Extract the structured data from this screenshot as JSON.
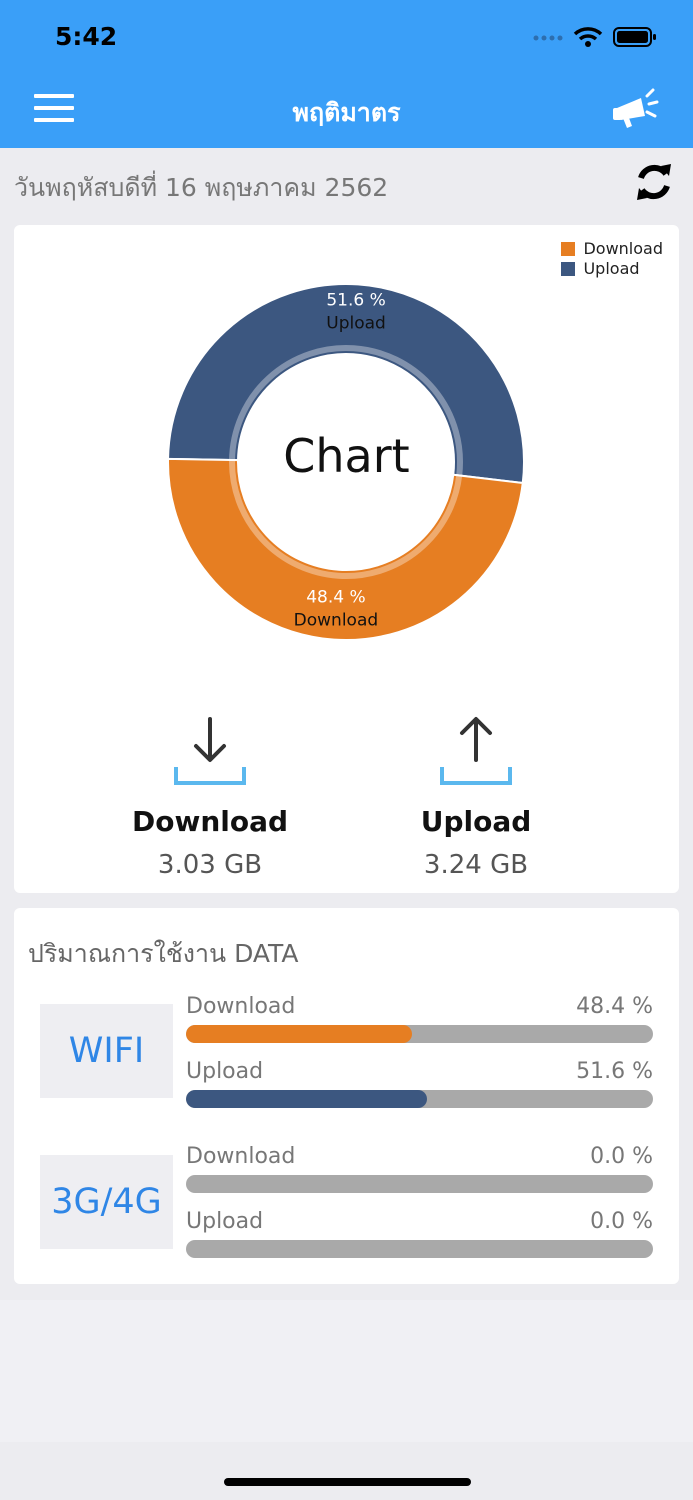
{
  "status": {
    "time": "5:42"
  },
  "nav": {
    "title": "พฤติมาตร"
  },
  "date": {
    "text": "วันพฤหัสบดีที่ 16 พฤษภาคม 2562"
  },
  "colors": {
    "download": "#e67e22",
    "upload": "#3c5780",
    "accent": "#3a9ff8",
    "track": "#a9a9a9"
  },
  "chart_data": {
    "type": "pie",
    "title": "Chart",
    "legend": "top-right",
    "slices": [
      {
        "name": "Upload",
        "value": 51.6,
        "label": "51.6 %",
        "color": "#3c5780"
      },
      {
        "name": "Download",
        "value": 48.4,
        "label": "48.4 %",
        "color": "#e67e22"
      }
    ]
  },
  "totals": {
    "download": {
      "label": "Download",
      "value": "3.03 GB"
    },
    "upload": {
      "label": "Upload",
      "value": "3.24 GB"
    }
  },
  "usage": {
    "title": "ปริมาณการใช้งาน DATA",
    "wifi": {
      "label": "WIFI",
      "download": {
        "label": "Download",
        "percent_text": "48.4 %",
        "percent": 48.4
      },
      "upload": {
        "label": "Upload",
        "percent_text": "51.6 %",
        "percent": 51.6
      }
    },
    "cellular": {
      "label": "3G/4G",
      "download": {
        "label": "Download",
        "percent_text": "0.0 %",
        "percent": 0.0
      },
      "upload": {
        "label": "Upload",
        "percent_text": "0.0 %",
        "percent": 0.0
      }
    }
  }
}
